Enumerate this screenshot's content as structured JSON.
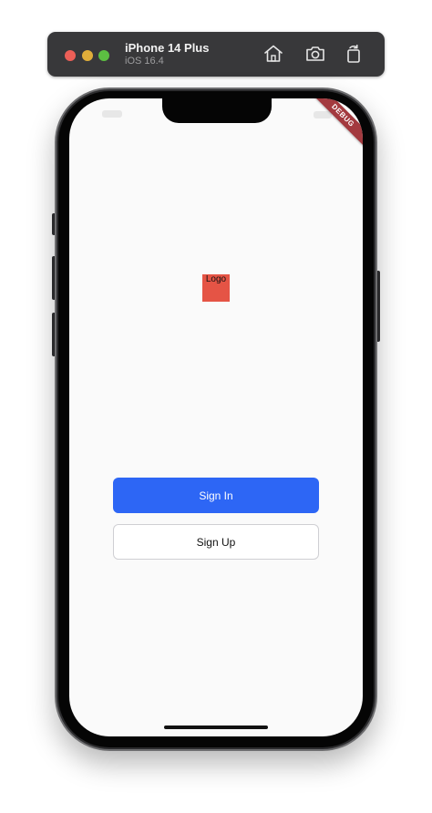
{
  "simulator": {
    "device_name": "iPhone 14 Plus",
    "os_version": "iOS 16.4",
    "colors": {
      "toolbar": "#38383a",
      "close": "#ec5f57",
      "minimize": "#e0ae3a",
      "zoom": "#5cbf42"
    },
    "toolbar_icons": [
      "home-icon",
      "screenshot-icon",
      "rotate-icon"
    ]
  },
  "app": {
    "debug_banner": "DEBUG",
    "logo_text": "Logo",
    "sign_in_label": "Sign In",
    "sign_up_label": "Sign Up",
    "colors": {
      "background": "#fafafa",
      "logo": "#e55445",
      "primary": "#2d66f5",
      "debug_banner": "#a33a3f"
    }
  }
}
